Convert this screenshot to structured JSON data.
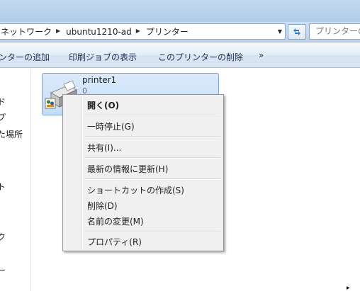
{
  "address_bar": {
    "breadcrumbs": [
      "ネットワーク",
      "ubuntu1210-ad",
      "プリンター"
    ],
    "search_placeholder": "プリンターの"
  },
  "command_bar": {
    "items": [
      "ンターの追加",
      "印刷ジョブの表示",
      "このプリンターの削除",
      "»"
    ]
  },
  "nav_pane": {
    "items": [
      "ド",
      "プ",
      "た場所",
      "ト",
      "ク",
      "ー"
    ]
  },
  "printer": {
    "name": "printer1",
    "status": "0"
  },
  "context_menu": {
    "items": [
      {
        "label": "開く(O)",
        "bold": true
      },
      {
        "label": "一時停止(G)"
      },
      {
        "label": "共有(I)..."
      },
      {
        "label": "最新の情報に更新(H)"
      },
      {
        "label": "ショートカットの作成(S)"
      },
      {
        "label": "削除(D)"
      },
      {
        "label": "名前の変更(M)"
      },
      {
        "label": "プロパティ(R)"
      }
    ]
  },
  "colors": {
    "tile_selected": "#c3dcf7",
    "menu_bg": "#f0f0f0",
    "toolbar_text": "#1e2f4f"
  }
}
